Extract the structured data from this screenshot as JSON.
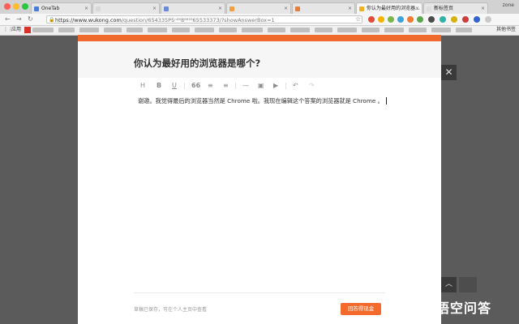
{
  "browser": {
    "tabs": [
      {
        "label": "OneTab",
        "fav": "#4a7bd6"
      },
      {
        "label": "",
        "fav": "#d8d8d8"
      },
      {
        "label": "",
        "fav": "#6a8ad8"
      },
      {
        "label": "",
        "fav": "#f0a040"
      },
      {
        "label": "",
        "fav": "#e08040"
      },
      {
        "label": "你认为最好用的浏览器...",
        "fav": "#f0b020"
      },
      {
        "label": "新标签页",
        "fav": "#dddddd"
      }
    ],
    "profile": "zone",
    "url_host": "https://www.wukong.com",
    "url_path": "/question/654335P5ⁿ³⁸8⁸⁸³³65533373/?showAnswerBox=1",
    "bookmarks_apps": "应用",
    "bookmarks_other": "其他书签",
    "ext_colors": [
      "#e24b3c",
      "#f4b400",
      "#7ab648",
      "#3fa3d9",
      "#f07b35",
      "#59a84b",
      "#4c4c4c",
      "#2fb3a4",
      "#d7b10d",
      "#cc3d3d",
      "#3366cc",
      "#c9c9c9"
    ]
  },
  "dialog": {
    "title": "你认为最好用的浏览器是哪个?",
    "toolbar": {
      "heading": "H",
      "bold": "B",
      "underline": "U",
      "quote": "66",
      "ordered_list": "≡",
      "bullet_list": "≡",
      "divider": "—",
      "image": "▣",
      "video": "▶",
      "undo": "↶",
      "redo": "↷"
    },
    "editor_text": "谢邀。我觉得最后的浏览器当然是 Chrome 啦。我现在编辑这个答案的浏览器就是 Chrome 。",
    "footer_note": "草稿已保存，可在个人主页中查看",
    "submit_label": "回答得现金"
  },
  "overlay": {
    "close_label": "✕",
    "scroll_top_label": "︿"
  },
  "watermark": {
    "text": "悟空问答"
  }
}
